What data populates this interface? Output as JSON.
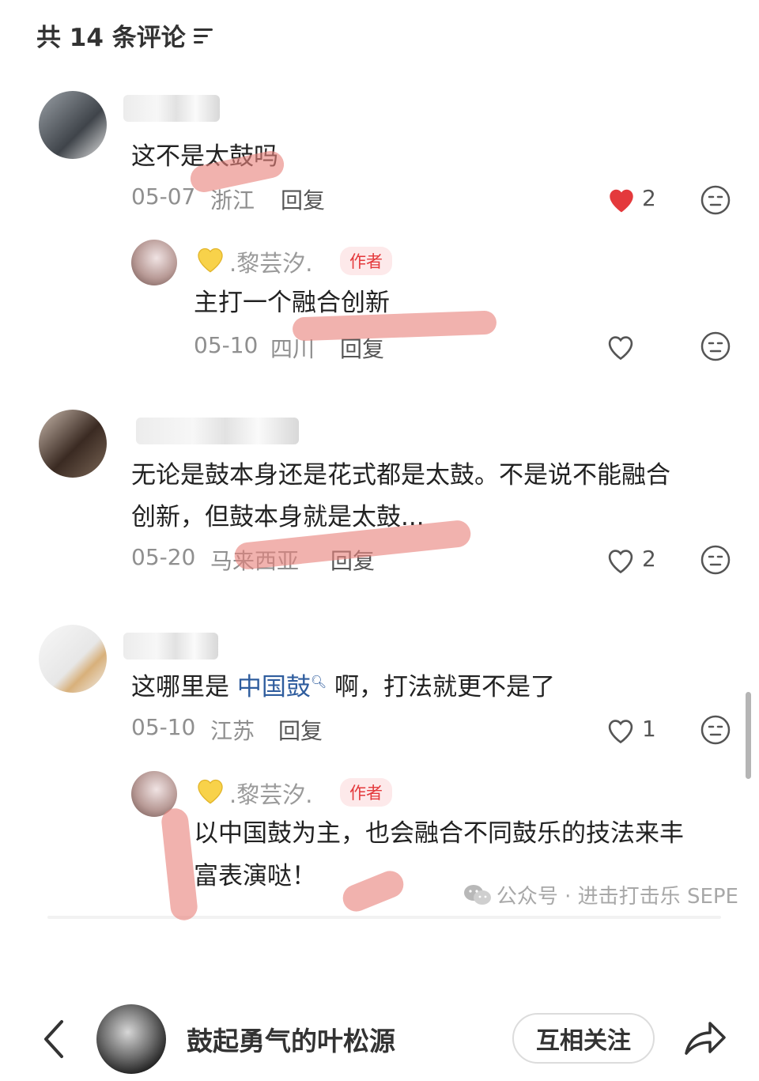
{
  "header": {
    "title": "共 14 条评论",
    "filter_icon": "filter-icon"
  },
  "comments": [
    {
      "text": "这不是太鼓吗",
      "date": "05-07",
      "location": "浙江",
      "reply_label": "回复",
      "likes": "2",
      "liked": true
    },
    {
      "author_name": ".黎芸汐.",
      "author_badge": "作者",
      "text": "主打一个融合创新",
      "date": "05-10",
      "location": "四川",
      "reply_label": "回复"
    },
    {
      "text_line1": "无论是鼓本身还是花式都是太鼓。不是说不能融合",
      "text_line2": "创新，但鼓本身就是太鼓...",
      "date": "05-20",
      "location": "马来西亚",
      "reply_label": "回复",
      "likes": "2"
    },
    {
      "text_before": "这哪里是",
      "link": "中国鼓",
      "text_after": "啊，打法就更不是了",
      "date": "05-10",
      "location": "江苏",
      "reply_label": "回复",
      "likes": "1"
    },
    {
      "author_name": ".黎芸汐.",
      "author_badge": "作者",
      "text_line1": "以中国鼓为主，也会融合不同鼓乐的技法来丰",
      "text_line2": "富表演哒！"
    }
  ],
  "watermark": "公众号 · 进击打击乐 SEPE",
  "bottom_bar": {
    "user_name": "鼓起勇气的叶松源",
    "follow_label": "互相关注"
  },
  "colors": {
    "accent_red": "#e4393c",
    "link_blue": "#2f5d9e",
    "annotation": "#e8827d"
  }
}
